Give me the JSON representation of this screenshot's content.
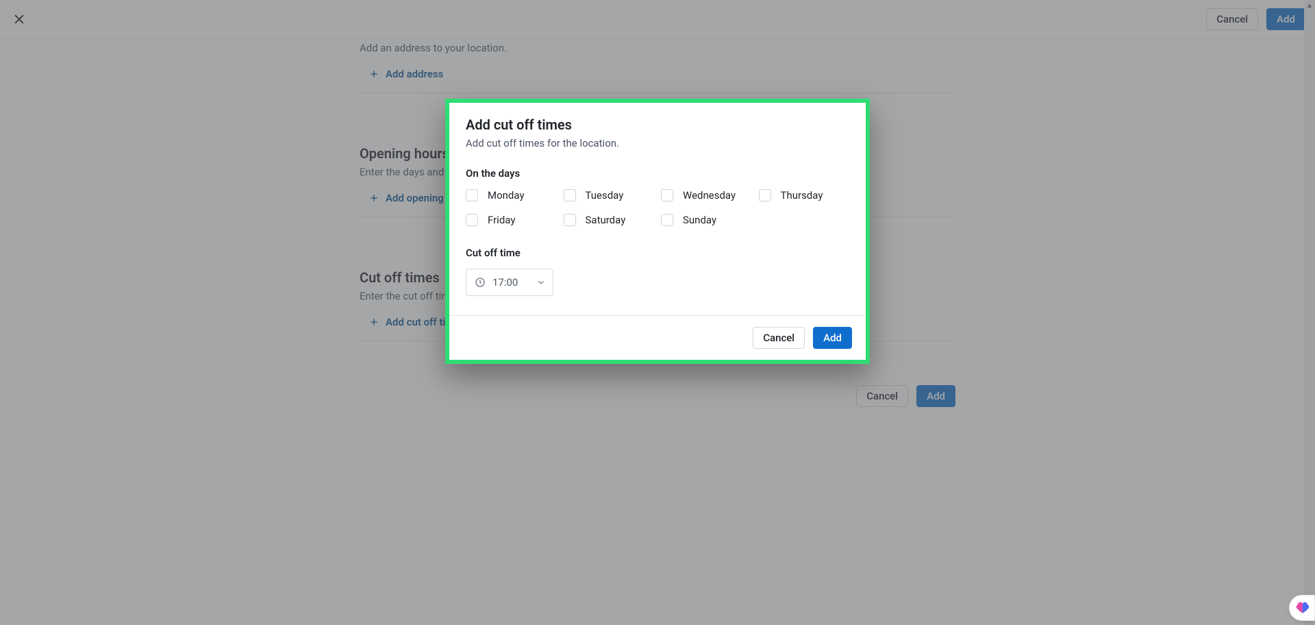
{
  "topbar": {
    "cancel": "Cancel",
    "add": "Add"
  },
  "page": {
    "address": {
      "desc": "Add an address to your location.",
      "add_link": "Add address"
    },
    "opening": {
      "title": "Opening hours",
      "desc": "Enter the days and h",
      "add_link": "Add opening h"
    },
    "cutoff": {
      "title": "Cut off times",
      "desc": "Enter the cut off time",
      "add_link": "Add cut off tim"
    },
    "footer": {
      "cancel": "Cancel",
      "add": "Add"
    }
  },
  "modal": {
    "title": "Add cut off times",
    "subtitle": "Add cut off times for the location.",
    "days_label": "On the days",
    "days": [
      "Monday",
      "Tuesday",
      "Wednesday",
      "Thursday",
      "Friday",
      "Saturday",
      "Sunday"
    ],
    "time_label": "Cut off time",
    "time_value": "17:00",
    "cancel": "Cancel",
    "add": "Add"
  },
  "colors": {
    "primary": "#0f6ecd",
    "highlight_border": "#2fdc74",
    "link": "#0b5394"
  }
}
